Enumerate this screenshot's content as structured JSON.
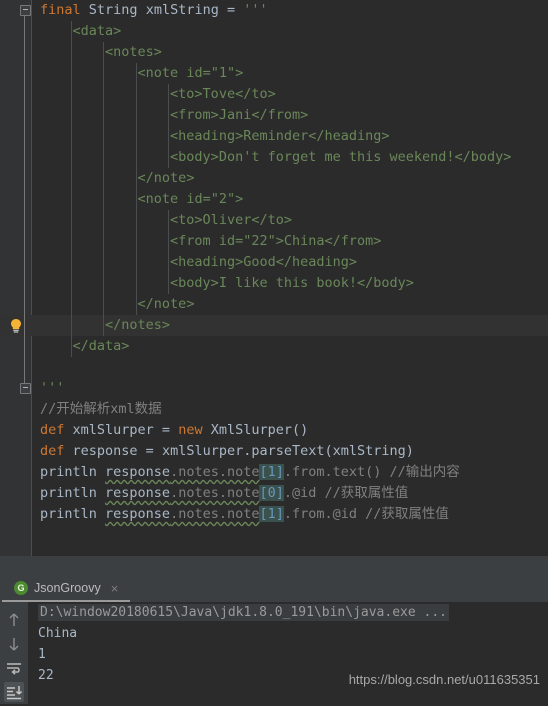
{
  "editor": {
    "language": "groovy",
    "caret_line_index": 15,
    "lines": [
      {
        "indent": 0,
        "tokens": [
          {
            "t": "final ",
            "c": "kw"
          },
          {
            "t": "String ",
            "c": "type"
          },
          {
            "t": "xmlString ",
            "c": "ident"
          },
          {
            "t": "= ",
            "c": "plain"
          },
          {
            "t": "'''",
            "c": "str"
          }
        ]
      },
      {
        "indent": 1,
        "tokens": [
          {
            "t": "<data>",
            "c": "xml"
          }
        ]
      },
      {
        "indent": 2,
        "tokens": [
          {
            "t": "<notes>",
            "c": "xml"
          }
        ]
      },
      {
        "indent": 3,
        "tokens": [
          {
            "t": "<note id=\"1\">",
            "c": "xml"
          }
        ]
      },
      {
        "indent": 4,
        "tokens": [
          {
            "t": "<to>Tove</to>",
            "c": "xml"
          }
        ]
      },
      {
        "indent": 4,
        "tokens": [
          {
            "t": "<from>Jani</from>",
            "c": "xml"
          }
        ]
      },
      {
        "indent": 4,
        "tokens": [
          {
            "t": "<heading>Reminder</heading>",
            "c": "xml"
          }
        ]
      },
      {
        "indent": 4,
        "tokens": [
          {
            "t": "<body>Don't forget me this weekend!</body>",
            "c": "xml"
          }
        ]
      },
      {
        "indent": 3,
        "tokens": [
          {
            "t": "</note>",
            "c": "xml"
          }
        ]
      },
      {
        "indent": 3,
        "tokens": [
          {
            "t": "<note id=\"2\">",
            "c": "xml"
          }
        ]
      },
      {
        "indent": 4,
        "tokens": [
          {
            "t": "<to>Oliver</to>",
            "c": "xml"
          }
        ]
      },
      {
        "indent": 4,
        "tokens": [
          {
            "t": "<from id=\"22\">China</from>",
            "c": "xml"
          }
        ]
      },
      {
        "indent": 4,
        "tokens": [
          {
            "t": "<heading>Good</heading>",
            "c": "xml"
          }
        ]
      },
      {
        "indent": 4,
        "tokens": [
          {
            "t": "<body>I like this book!</body>",
            "c": "xml"
          }
        ]
      },
      {
        "indent": 3,
        "tokens": [
          {
            "t": "</note>",
            "c": "xml"
          }
        ]
      },
      {
        "indent": 2,
        "tokens": [
          {
            "t": "</notes>",
            "c": "xml"
          }
        ]
      },
      {
        "indent": 1,
        "tokens": [
          {
            "t": "</data>",
            "c": "xml"
          }
        ]
      },
      {
        "indent": 0,
        "tokens": []
      },
      {
        "indent": 0,
        "tokens": [
          {
            "t": "'''",
            "c": "str"
          }
        ]
      },
      {
        "indent": 0,
        "tokens": [
          {
            "t": "//开始解析xml数据",
            "c": "cmt"
          }
        ]
      },
      {
        "indent": 0,
        "tokens": [
          {
            "t": "def ",
            "c": "kw"
          },
          {
            "t": "xmlSlurper ",
            "c": "ident"
          },
          {
            "t": "= ",
            "c": "plain"
          },
          {
            "t": "new ",
            "c": "kw"
          },
          {
            "t": "XmlSlurper()",
            "c": "type"
          }
        ]
      },
      {
        "indent": 0,
        "tokens": [
          {
            "t": "def ",
            "c": "kw"
          },
          {
            "t": "response ",
            "c": "ident"
          },
          {
            "t": "= ",
            "c": "plain"
          },
          {
            "t": "xmlSlurper.parseText(xmlString)",
            "c": "plain"
          }
        ]
      },
      {
        "indent": 0,
        "tokens": [
          {
            "t": "println ",
            "c": "plain"
          },
          {
            "t": "response",
            "c": "squig"
          },
          {
            "t": ".notes",
            "c": "squigdim"
          },
          {
            "t": ".note",
            "c": "squigdim"
          },
          {
            "t": "[1]",
            "c": "brackethl"
          },
          {
            "t": ".from",
            "c": "dim"
          },
          {
            "t": ".text()",
            "c": "dim"
          },
          {
            "t": " //输出内容",
            "c": "cmt"
          }
        ]
      },
      {
        "indent": 0,
        "tokens": [
          {
            "t": "println ",
            "c": "plain"
          },
          {
            "t": "response",
            "c": "squig"
          },
          {
            "t": ".notes",
            "c": "squigdim"
          },
          {
            "t": ".note",
            "c": "squigdim"
          },
          {
            "t": "[0]",
            "c": "brackethl"
          },
          {
            "t": ".@id",
            "c": "dim"
          },
          {
            "t": " //获取属性值",
            "c": "cmt"
          }
        ]
      },
      {
        "indent": 0,
        "tokens": [
          {
            "t": "println ",
            "c": "plain"
          },
          {
            "t": "response",
            "c": "squig"
          },
          {
            "t": ".notes",
            "c": "squigdim"
          },
          {
            "t": ".note",
            "c": "squigdim"
          },
          {
            "t": "[1]",
            "c": "brackethl"
          },
          {
            "t": ".from",
            "c": "dim"
          },
          {
            "t": ".@id",
            "c": "dim"
          },
          {
            "t": " //获取属性值",
            "c": "cmt"
          }
        ]
      }
    ],
    "fold_markers": [
      {
        "line": 0
      },
      {
        "line": 18
      }
    ],
    "lightbulb": {
      "line": 15,
      "name": "intention-bulb"
    }
  },
  "tool_window": {
    "tab": {
      "icon": "G",
      "label": "JsonGroovy",
      "close": "×"
    },
    "gutter_icons": [
      {
        "name": "scroll-up-icon",
        "glyph": "↑",
        "active": false
      },
      {
        "name": "scroll-down-icon",
        "glyph": "↓",
        "active": false
      },
      {
        "name": "soft-wrap-icon",
        "glyph": "wrap",
        "active": false
      },
      {
        "name": "scroll-to-end-icon",
        "glyph": "end",
        "active": true
      }
    ],
    "console": {
      "command": "D:\\window20180615\\Java\\jdk1.8.0_191\\bin\\java.exe ...",
      "output": [
        "China",
        "1",
        "22"
      ]
    }
  },
  "watermark": {
    "text": "https://blog.csdn.net/u011635351"
  },
  "colors": {
    "editor_bg": "#2b2b2b",
    "gutter_bg": "#313335",
    "panel_bg": "#3c3f41",
    "keyword": "#cc7832",
    "string": "#6a8759",
    "comment": "#808080",
    "default_text": "#a9b7c6",
    "number": "#6897bb",
    "caret_row": "#323232",
    "tab_badge_green": "#4d8b31"
  }
}
